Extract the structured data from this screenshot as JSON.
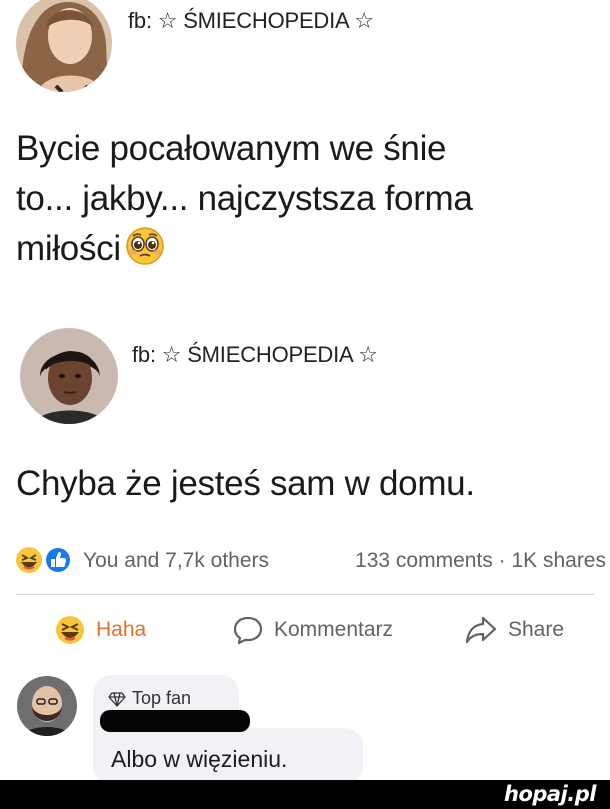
{
  "post1": {
    "author": "fb: ☆ ŚMIECHOPEDIA ☆",
    "lines": [
      "Bycie pocałowanym we śnie",
      "to... jakby... najczystsza forma",
      "miłości"
    ],
    "emoji": "pleading-face-icon"
  },
  "post2": {
    "author": "fb: ☆ ŚMIECHOPEDIA ☆",
    "text": "Chyba że jesteś sam w domu."
  },
  "stats": {
    "reactions_text": "You and 7,7k others",
    "comments_shares": "133 comments · 1K shares",
    "reaction_icons": [
      "haha-icon",
      "like-icon"
    ]
  },
  "actions": {
    "haha": "Haha",
    "comment": "Kommentarz",
    "share": "Share"
  },
  "comment": {
    "badge": "Top fan",
    "text": "Albo w więzieniu."
  },
  "watermark": "hopaj.pl",
  "colors": {
    "haha_orange": "#e8702a",
    "like_blue": "#1877f2",
    "emoji_yellow": "#f7c63c",
    "muted_text": "#5f6368"
  }
}
